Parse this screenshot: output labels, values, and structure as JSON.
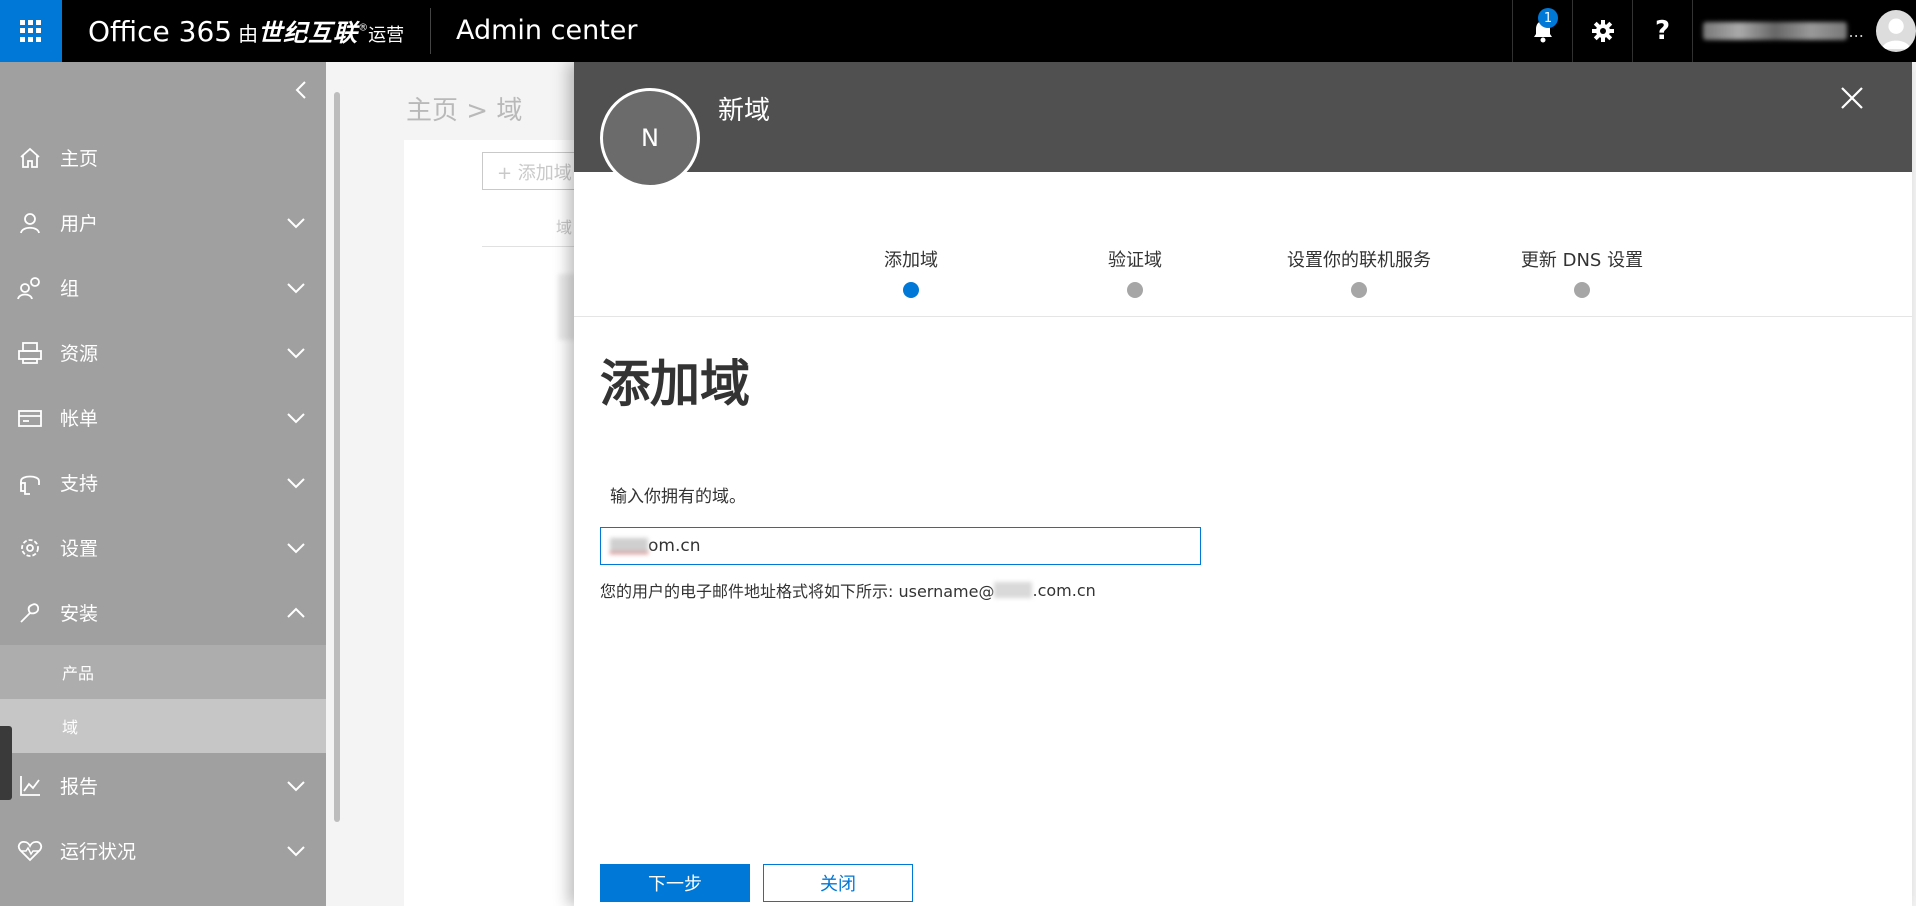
{
  "topbar": {
    "brand": "Office 365",
    "brand_by": "由",
    "brand_partner": "世纪互联",
    "brand_reg": "®",
    "brand_operated": "运营",
    "app_title": "Admin center",
    "notification_count": "1",
    "help_glyph": "?",
    "user_ellipsis": "..."
  },
  "breadcrumb": "主页 > 域",
  "background_page": {
    "add_button": "+ 添加域",
    "column_header": "域"
  },
  "sidebar": {
    "items": [
      {
        "label": "主页",
        "icon": "home-icon"
      },
      {
        "label": "用户",
        "icon": "user-icon"
      },
      {
        "label": "组",
        "icon": "group-icon"
      },
      {
        "label": "资源",
        "icon": "resources-icon"
      },
      {
        "label": "帐单",
        "icon": "billing-icon"
      },
      {
        "label": "支持",
        "icon": "headset-icon"
      },
      {
        "label": "设置",
        "icon": "gear-icon"
      },
      {
        "label": "安装",
        "icon": "wrench-icon"
      },
      {
        "label": "报告",
        "icon": "chart-icon"
      },
      {
        "label": "运行状况",
        "icon": "heart-icon"
      }
    ],
    "sub_items": [
      {
        "label": "产品"
      },
      {
        "label": "域",
        "active": true
      }
    ]
  },
  "panel": {
    "avatar_letter": "N",
    "title": "新域",
    "steps": [
      {
        "label": "添加域",
        "active": true
      },
      {
        "label": "验证域",
        "active": false
      },
      {
        "label": "设置你的联机服务",
        "active": false
      },
      {
        "label": "更新 DNS 设置",
        "active": false
      }
    ],
    "heading": "添加域",
    "domain_label": "输入你拥有的域。",
    "domain_value_suffix": "om.cn",
    "email_hint_prefix": "您的用户的电子邮件地址格式将如下所示: username@",
    "email_hint_suffix": ".com.cn",
    "next_button": "下一步",
    "close_button": "关闭"
  },
  "colors": {
    "accent": "#0078d7",
    "topbar": "#000000",
    "sidebar": "#a0a0a0",
    "panel_header": "#505050"
  }
}
